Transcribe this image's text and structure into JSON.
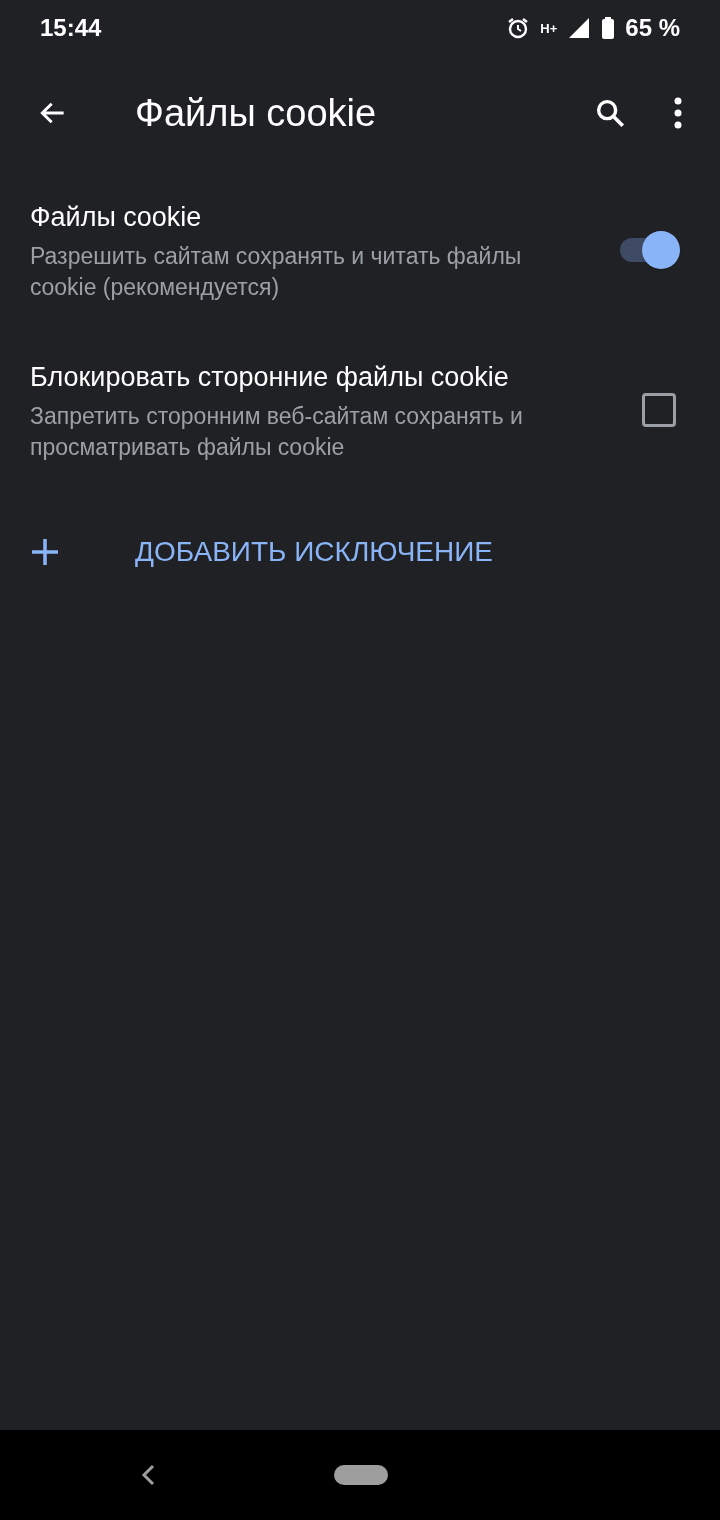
{
  "status_bar": {
    "time": "15:44",
    "network_type": "H+",
    "battery": "65 %"
  },
  "toolbar": {
    "title": "Файлы cookie"
  },
  "settings": [
    {
      "kind": "toggle",
      "title": "Файлы cookie",
      "summary": "Разрешить сайтам сохранять и читать файлы cookie (рекомендуется)",
      "on": true
    },
    {
      "kind": "checkbox",
      "title": "Блокировать сторонние файлы cookie",
      "summary": "Запретить сторонним веб-сайтам сохранять и просматривать файлы cookie",
      "on": false
    }
  ],
  "add_exception": {
    "label": "ДОБАВИТЬ ИСКЛЮЧЕНИЕ"
  }
}
